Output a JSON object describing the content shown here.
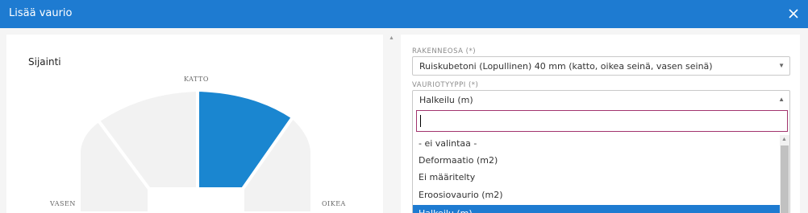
{
  "dialog": {
    "title": "Lisää vaurio",
    "close_icon": "close-icon"
  },
  "location": {
    "title": "Sijainti",
    "labels": {
      "roof": "KATTO",
      "left": "VASEN",
      "right": "OIKEA"
    },
    "selected_color": "#1a86d0",
    "unselected_color": "#f2f2f2"
  },
  "form": {
    "structure_label": "RAKENNEOSA (*)",
    "structure_value": "Ruiskubetoni (Lopullinen) 40 mm (katto, oikea seinä, vasen seinä)",
    "damage_type_label": "VAURIOTYYPPI (*)",
    "damage_type_value": "Halkeilu (m)",
    "search_value": "",
    "options": [
      "- ei valintaa -",
      "Deformaatio (m2)",
      "Ei määritelty",
      "Eroosiovaurio (m2)",
      "Halkeilu (m)"
    ]
  },
  "accent_color": "#1e7bd1"
}
